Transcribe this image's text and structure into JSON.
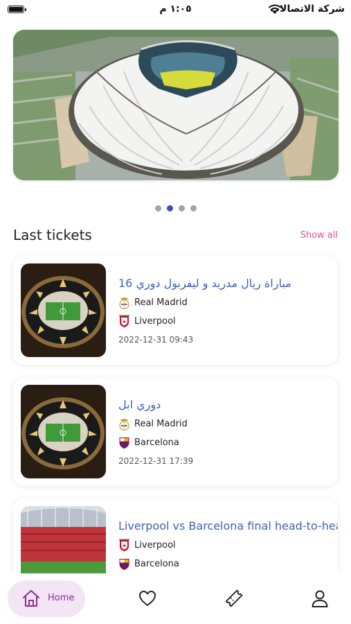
{
  "status_bar": {
    "time": "١:٠٥ م",
    "carrier": "شركة الاتصالات"
  },
  "carousel": {
    "page_count": 4,
    "active_index": 1
  },
  "section": {
    "title": "Last tickets",
    "show_all_label": "Show all"
  },
  "tickets": [
    {
      "title": "مباراة ريال مدريد و ليفربول دوري 16",
      "home_team": "Real Madrid",
      "away_team": "Liverpool",
      "datetime": "2022-12-31 09:43"
    },
    {
      "title": "دوري ابل",
      "home_team": "Real Madrid",
      "away_team": "Barcelona",
      "datetime": "2022-12-31 17:39"
    },
    {
      "title": "Liverpool vs Barcelona final head-to-head",
      "home_team": "Liverpool",
      "away_team": "Barcelona",
      "datetime": ""
    }
  ],
  "bottom_nav": {
    "home_label": "Home",
    "items": [
      "home-icon",
      "heart-icon",
      "ticket-icon",
      "profile-icon"
    ]
  },
  "colors": {
    "accent_blue": "#3d62b3",
    "show_all_pink": "#e04f8c",
    "nav_active_bg": "#f3e4f6",
    "nav_active_fg": "#8a2f95",
    "dot_active": "#3b4fbf"
  }
}
